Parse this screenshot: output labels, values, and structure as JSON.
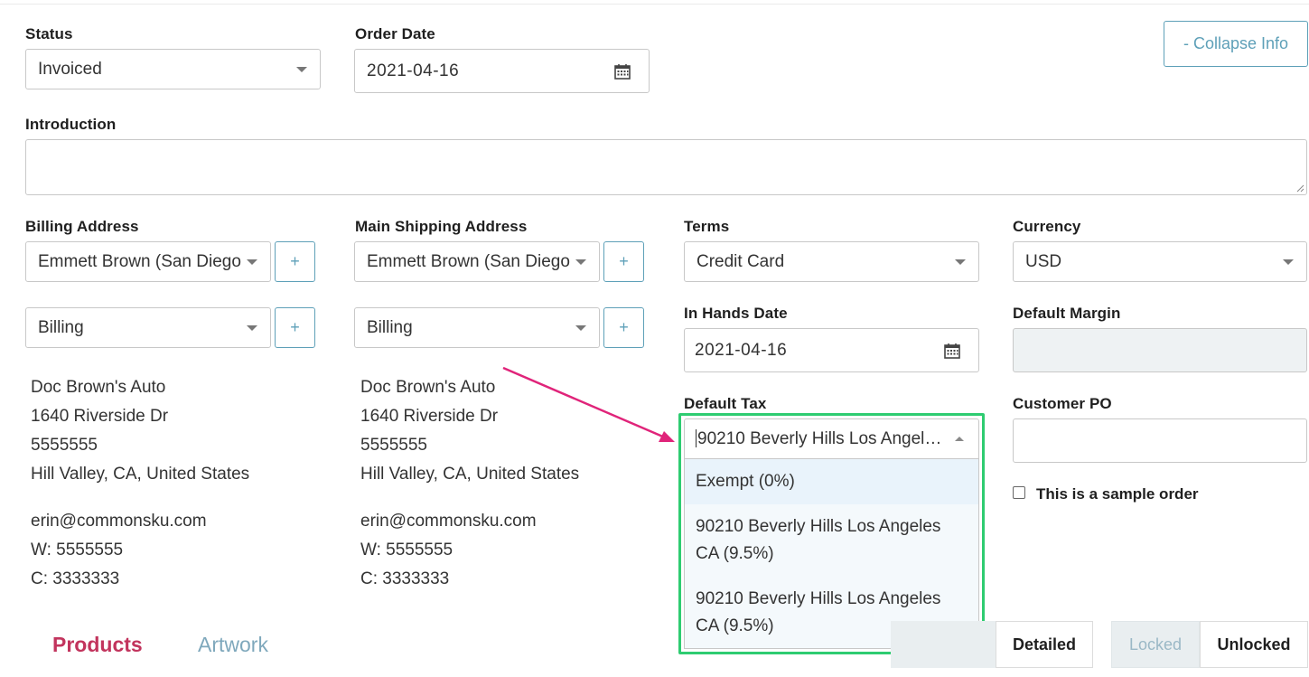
{
  "header": {
    "collapse_label": "- Collapse Info"
  },
  "status": {
    "label": "Status",
    "value": "Invoiced"
  },
  "order_date": {
    "label": "Order Date",
    "value": "2021-04-16"
  },
  "introduction": {
    "label": "Introduction",
    "value": ""
  },
  "billing": {
    "label": "Billing Address",
    "contact": "Emmett Brown (San Diego",
    "type": "Billing",
    "plus": "+",
    "address_lines": [
      "Doc Brown's Auto",
      "1640 Riverside Dr",
      "5555555",
      "Hill Valley, CA, United States"
    ],
    "contact_lines": [
      "erin@commonsku.com",
      "W: 5555555",
      "C: 3333333"
    ]
  },
  "shipping": {
    "label": "Main Shipping Address",
    "contact": "Emmett Brown (San Diego",
    "type": "Billing",
    "plus": "+",
    "address_lines": [
      "Doc Brown's Auto",
      "1640 Riverside Dr",
      "5555555",
      "Hill Valley, CA, United States"
    ],
    "contact_lines": [
      "erin@commonsku.com",
      "W: 5555555",
      "C: 3333333"
    ]
  },
  "terms": {
    "label": "Terms",
    "value": "Credit Card"
  },
  "currency": {
    "label": "Currency",
    "value": "USD"
  },
  "in_hands_date": {
    "label": "In Hands Date",
    "value": "2021-04-16"
  },
  "default_margin": {
    "label": "Default Margin",
    "value": ""
  },
  "default_tax": {
    "label": "Default Tax",
    "value": "90210 Beverly Hills Los Angeles CA (9.5%)",
    "options": [
      {
        "label": "Exempt (0%)"
      },
      {
        "label": "90210 Beverly Hills Los Angeles CA (9.5%)"
      },
      {
        "label": "90210 Beverly Hills Los Angeles CA (9.5%)"
      }
    ]
  },
  "customer_po": {
    "label": "Customer PO",
    "value": ""
  },
  "sample_order": {
    "label": "This is a sample order",
    "checked": false
  },
  "tabs": {
    "products": "Products",
    "artwork": "Artwork"
  },
  "view_toggle": {
    "detailed": "Detailed"
  },
  "lock_toggle": {
    "locked": "Locked",
    "unlocked": "Unlocked"
  },
  "colors": {
    "accent": "#5ea0b8",
    "highlight": "#2ecc71",
    "arrow": "#e0247a",
    "active_tab": "#c2345d"
  }
}
